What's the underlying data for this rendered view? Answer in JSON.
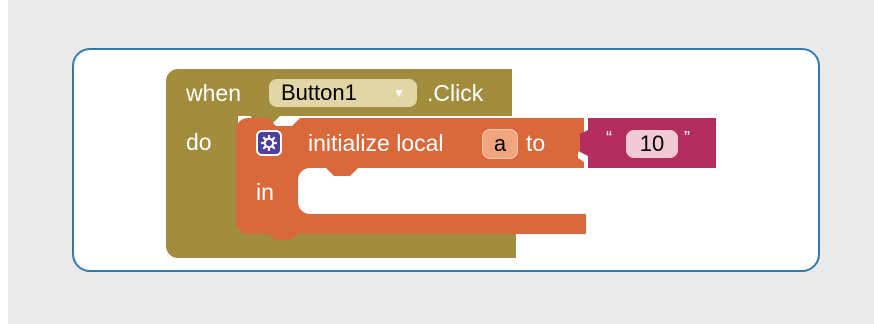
{
  "event_block": {
    "when_label": "when",
    "component": "Button1",
    "dropdown_arrow": "▼",
    "event_name": ".Click",
    "do_label": "do"
  },
  "local_block": {
    "icon": "gear-icon",
    "initialize_label": "initialize local",
    "var_name": "a",
    "to_label": "to",
    "in_label": "in"
  },
  "text_block": {
    "open_quote": "“",
    "value": "10",
    "close_quote": "”"
  },
  "colors": {
    "event_block": "#a28c3d",
    "local_block": "#d9683b",
    "text_block": "#b32d5e",
    "gear_icon": "#4f3ea0",
    "panel_border": "#2e7ab3"
  }
}
